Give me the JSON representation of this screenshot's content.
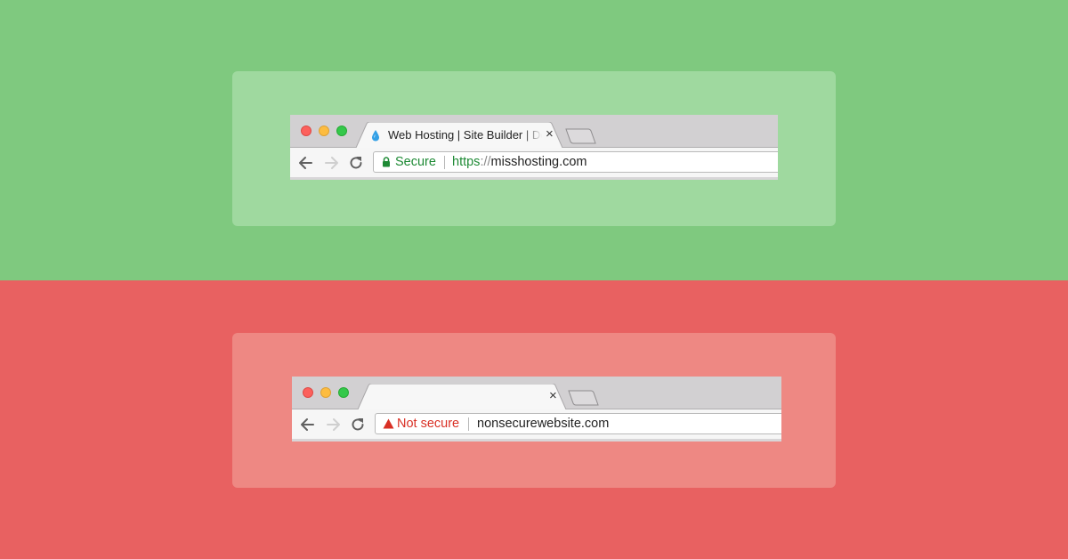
{
  "secure_example": {
    "tab": {
      "title": "Web Hosting | Site Builder | Do",
      "favicon": "droplet-icon",
      "close": "×"
    },
    "address_bar": {
      "status_label": "Secure",
      "status_icon": "lock-icon",
      "url_scheme": "https",
      "url_separator": "://",
      "url_host": "misshosting.com"
    }
  },
  "insecure_example": {
    "tab": {
      "title": "",
      "close": "×"
    },
    "address_bar": {
      "status_label": "Not secure",
      "status_icon": "warning-triangle-icon",
      "url_host": "nonsecurewebsite.com"
    }
  },
  "colors": {
    "secure_background": "#7fc97f",
    "insecure_background": "#e86161",
    "secure_text": "#1e8a35",
    "insecure_text": "#d93025"
  }
}
